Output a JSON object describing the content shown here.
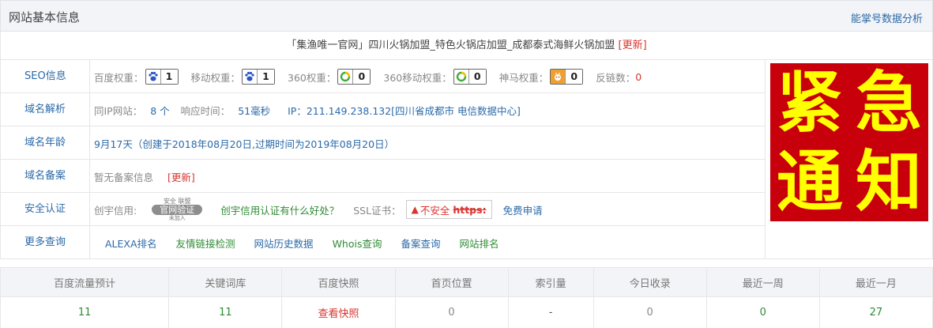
{
  "header": {
    "title": "网站基本信息",
    "link": "能掌号数据分析"
  },
  "site_title": {
    "text": "「集渔唯一官网」四川火锅加盟_特色火锅店加盟_成都泰式海鲜火锅加盟",
    "update": "[更新]"
  },
  "rows": {
    "seo": {
      "label": "SEO信息",
      "baidu_label": "百度权重：",
      "baidu_value": "1",
      "mobile_label": "移动权重：",
      "mobile_value": "1",
      "s360_label": "360权重：",
      "s360_value": "0",
      "s360m_label": "360移动权重：",
      "s360m_value": "0",
      "shenma_label": "神马权重：",
      "shenma_value": "0",
      "backlinks_label": "反链数：",
      "backlinks_value": "0"
    },
    "dns": {
      "label": "域名解析",
      "sameip_label": "同IP网站：",
      "sameip_value": "8 个",
      "resp_label": "响应时间：",
      "resp_value": "51毫秒",
      "ip_text": "IP：211.149.238.132[四川省成都市 电信数据中心]"
    },
    "age": {
      "label": "域名年龄",
      "text": "9月17天（创建于2018年08月20日,过期时间为2019年08月20日）"
    },
    "icp": {
      "label": "域名备案",
      "text": "暂无备案信息",
      "update": "[更新]"
    },
    "security": {
      "label": "安全认证",
      "credit_label": "创宇信用:",
      "seal_top": "安全 联盟",
      "seal_mid": "官网验证",
      "seal_bot": "未加入",
      "credit_link": "创宇信用认证有什么好处？",
      "ssl_label": "SSL证书：",
      "ssl_status": "不安全",
      "ssl_https": "https:",
      "ssl_apply": "免费申请"
    },
    "more": {
      "label": "更多查询",
      "links": [
        "ALEXA排名",
        "友情链接检测",
        "网站历史数据",
        "Whois查询",
        "备案查询",
        "网站排名"
      ]
    }
  },
  "notice": {
    "chars": [
      "紧",
      "急",
      "通",
      "知"
    ]
  },
  "stats": {
    "headers": [
      "百度流量预计",
      "关键词库",
      "百度快照",
      "首页位置",
      "索引量",
      "今日收录",
      "最近一周",
      "最近一月"
    ],
    "values": [
      "11",
      "11",
      "查看快照",
      "0",
      "-",
      "0",
      "0",
      "27"
    ]
  },
  "colors": {
    "link_blue": "#2b6aa8",
    "green": "#2e8b34",
    "red": "#d9352f",
    "notice_bg": "#c8000c",
    "notice_text": "#ffff00"
  }
}
